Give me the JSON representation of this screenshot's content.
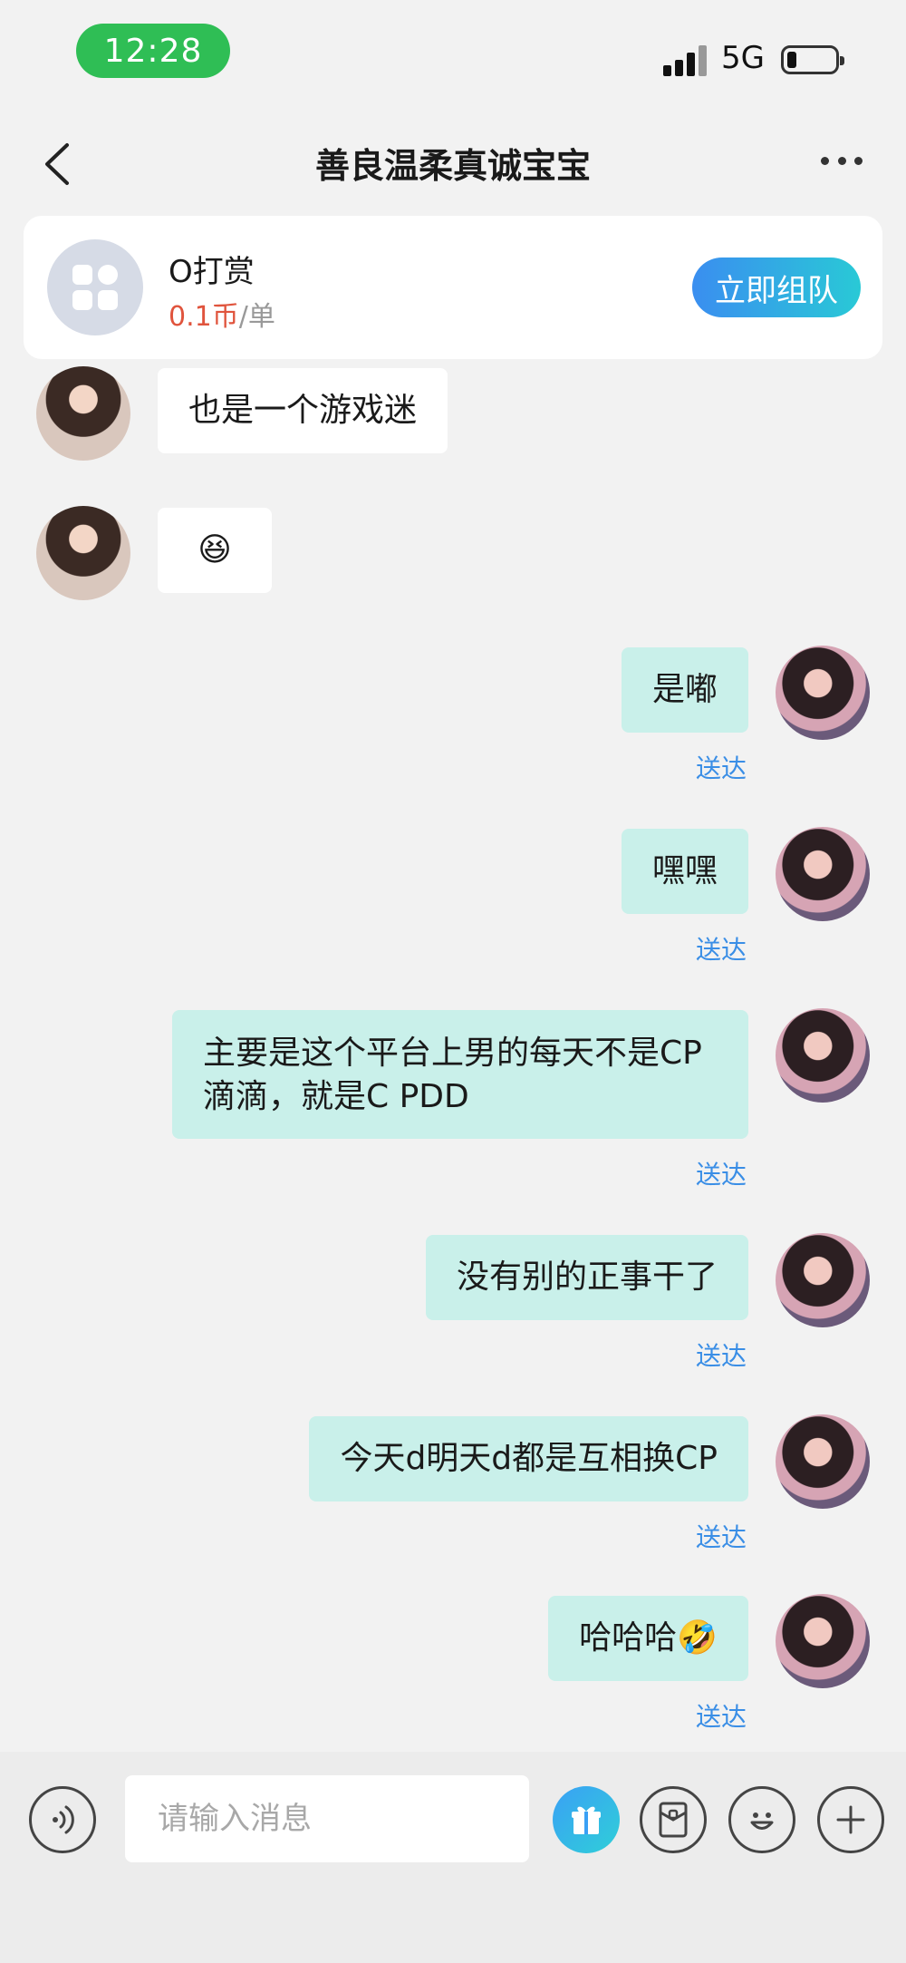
{
  "status_bar": {
    "time": "12:28",
    "network": "5G"
  },
  "nav": {
    "title": "善良温柔真诚宝宝"
  },
  "card": {
    "title": "O打赏",
    "price_value": "0.1币",
    "price_unit": "/单",
    "team_button": "立即组队"
  },
  "messages": [
    {
      "from": "them",
      "text": "也是一个游戏迷"
    },
    {
      "from": "them",
      "text": "😆"
    },
    {
      "from": "me",
      "text": "是嘟",
      "status": "送达"
    },
    {
      "from": "me",
      "text": "嘿嘿",
      "status": "送达"
    },
    {
      "from": "me",
      "text": "主要是这个平台上男的每天不是CP滴滴，就是C PDD",
      "status": "送达"
    },
    {
      "from": "me",
      "text": "没有别的正事干了",
      "status": "送达"
    },
    {
      "from": "me",
      "text": "今天d明天d都是互相换CP",
      "status": "送达"
    },
    {
      "from": "me",
      "text": "哈哈哈🤣",
      "status": "送达"
    }
  ],
  "input": {
    "placeholder": "请输入消息"
  }
}
